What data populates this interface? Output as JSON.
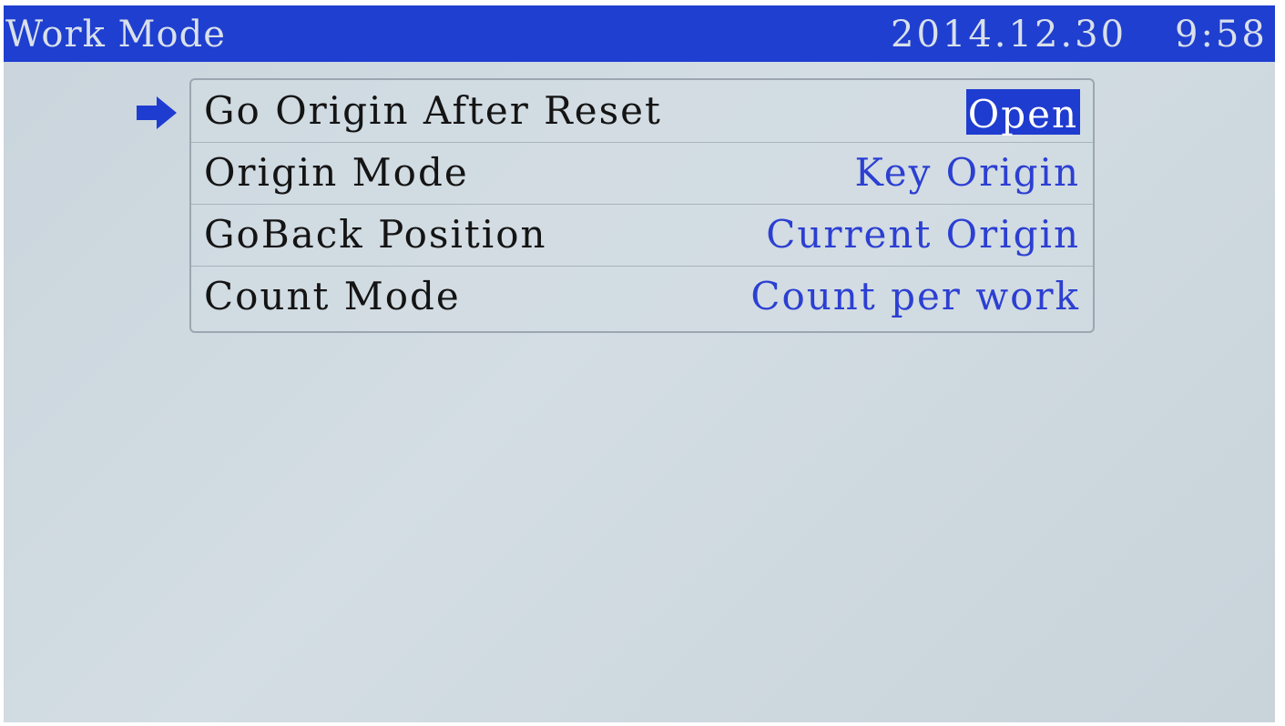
{
  "header": {
    "title": "Work Mode",
    "date": "2014.12.30",
    "time": "9:58"
  },
  "menu": {
    "items": [
      {
        "label": "Go Origin After Reset",
        "value": "Open",
        "selected": true
      },
      {
        "label": "Origin Mode",
        "value": "Key Origin",
        "selected": false
      },
      {
        "label": "GoBack Position",
        "value": "Current Origin",
        "selected": false
      },
      {
        "label": "Count Mode",
        "value": "Count per work",
        "selected": false
      }
    ]
  },
  "icons": {
    "selection_cursor": "arrow-right-icon"
  },
  "colors": {
    "title_bar": "#1f3fd0",
    "value_text": "#2c3fd2",
    "selected_highlight": "#1f3cd0",
    "screen_background": "#cdd7de"
  }
}
